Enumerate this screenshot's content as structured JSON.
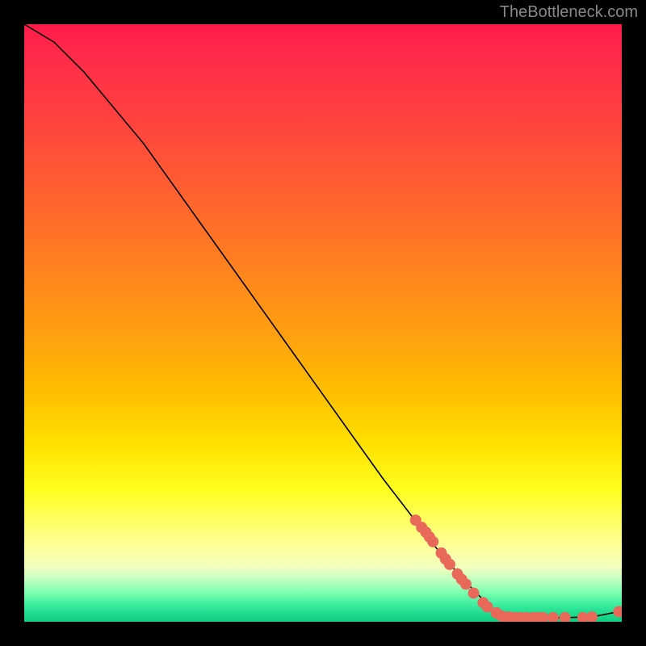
{
  "watermark": "TheBottleneck.com",
  "chart_data": {
    "type": "line",
    "title": "",
    "xlabel": "",
    "ylabel": "",
    "xlim": [
      0,
      100
    ],
    "ylim": [
      0,
      100
    ],
    "curve": {
      "name": "bottleneck-curve",
      "points": [
        {
          "x": 0,
          "y": 100
        },
        {
          "x": 5,
          "y": 97
        },
        {
          "x": 10,
          "y": 92
        },
        {
          "x": 15,
          "y": 86
        },
        {
          "x": 20,
          "y": 80
        },
        {
          "x": 25,
          "y": 73
        },
        {
          "x": 30,
          "y": 66
        },
        {
          "x": 35,
          "y": 59
        },
        {
          "x": 40,
          "y": 52
        },
        {
          "x": 45,
          "y": 45
        },
        {
          "x": 50,
          "y": 38
        },
        {
          "x": 55,
          "y": 31
        },
        {
          "x": 60,
          "y": 24
        },
        {
          "x": 65,
          "y": 17.5
        },
        {
          "x": 70,
          "y": 11
        },
        {
          "x": 75,
          "y": 5.5
        },
        {
          "x": 79,
          "y": 1.5
        },
        {
          "x": 81,
          "y": 0.8
        },
        {
          "x": 85,
          "y": 0.7
        },
        {
          "x": 90,
          "y": 0.7
        },
        {
          "x": 95,
          "y": 0.8
        },
        {
          "x": 100,
          "y": 1.8
        }
      ]
    },
    "markers": {
      "name": "data-points",
      "color": "#e8695a",
      "points": [
        {
          "x": 65.5,
          "y": 17.0
        },
        {
          "x": 66.5,
          "y": 15.8
        },
        {
          "x": 67.2,
          "y": 15.0
        },
        {
          "x": 67.8,
          "y": 14.2
        },
        {
          "x": 68.4,
          "y": 13.4
        },
        {
          "x": 69.8,
          "y": 11.5
        },
        {
          "x": 70.5,
          "y": 10.5
        },
        {
          "x": 71.2,
          "y": 9.6
        },
        {
          "x": 72.5,
          "y": 8.0
        },
        {
          "x": 73.2,
          "y": 7.1
        },
        {
          "x": 73.9,
          "y": 6.3
        },
        {
          "x": 75.2,
          "y": 4.8
        },
        {
          "x": 76.8,
          "y": 3.2
        },
        {
          "x": 77.5,
          "y": 2.5
        },
        {
          "x": 79.0,
          "y": 1.5
        },
        {
          "x": 79.8,
          "y": 1.0
        },
        {
          "x": 80.5,
          "y": 0.8
        },
        {
          "x": 81.3,
          "y": 0.8
        },
        {
          "x": 82.2,
          "y": 0.7
        },
        {
          "x": 83.0,
          "y": 0.7
        },
        {
          "x": 84.0,
          "y": 0.7
        },
        {
          "x": 85.2,
          "y": 0.7
        },
        {
          "x": 86.0,
          "y": 0.7
        },
        {
          "x": 86.8,
          "y": 0.7
        },
        {
          "x": 88.5,
          "y": 0.7
        },
        {
          "x": 90.5,
          "y": 0.7
        },
        {
          "x": 93.5,
          "y": 0.7
        },
        {
          "x": 95.0,
          "y": 0.8
        },
        {
          "x": 99.5,
          "y": 1.7
        }
      ]
    }
  }
}
